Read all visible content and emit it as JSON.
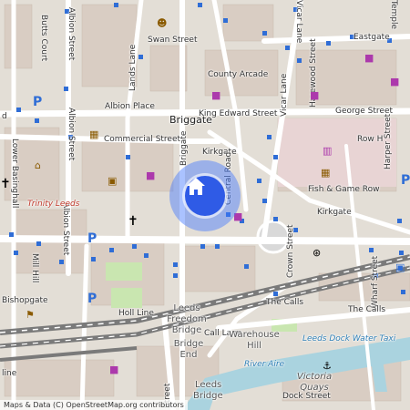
{
  "map": {
    "attribution": "Maps & Data (C) OpenStreetMap.org contributors",
    "location_marker": "home-icon",
    "colors": {
      "background": "#e3ded6",
      "street": "#ffffff",
      "building": "#d6c8bd",
      "water": "#aad3df",
      "rail": "#707070",
      "bus_stop": "#2f6dd6",
      "park": "#c9e6b0",
      "marker": "#2f5be6"
    },
    "labels": {
      "vicar_lane_top": "Vicar Lane",
      "eastgate": "Eastgate",
      "temple": "Temple",
      "butts_court": "Butts Court",
      "albion_street_top": "Albion Street",
      "lands_lane": "Lands Lane",
      "swan_street": "Swan Street",
      "county_arcade": "County Arcade",
      "harewood_street": "Harewood Street",
      "albion_place": "Albion Place",
      "briggate": "Briggate",
      "king_edward_street": "King Edward Street",
      "george_street": "George Street",
      "vicar_lane_mid": "Vicar Lane",
      "commercial_street": "Commercial Street",
      "albion_street_mid": "Albion Street",
      "albion_street_low": "Albion Street",
      "kirkgate_top": "Kirkgate",
      "row_h": "Row H",
      "harper_street": "Harper Street",
      "lower_basinghall": "Lower Basinghall",
      "briggate_side": "Briggate",
      "central_road": "Central Road",
      "trinity_leeds": "Trinity Leeds",
      "fish_game_row": "Fish & Game Row",
      "kirkgate_right": "Kirkgate",
      "mill_hill": "Mill Hill",
      "crown_street": "Crown Street",
      "bishopgate": "Bishopgate",
      "wharf_street": "Wharf Street",
      "the_calls_1": "The Calls",
      "the_calls_2": "The Calls",
      "leeds_freedom_bridge": "Leeds Freedom Bridge",
      "call_lane": "Call Lane",
      "warehouse_hill": "Warehouse Hill",
      "hol_line": "Holl Line",
      "leeds_dock_water_taxi": "Leeds Dock Water Taxi",
      "bridge_end": "Bridge End",
      "river_aire": "River Aire",
      "victoria_quays": "Victoria Quays",
      "leeds_bottom": "Leeds",
      "bridge_bottom": "Bridge",
      "street_bottom": "Street",
      "dock_street": "Dock Street",
      "nele_line": "line",
      "fd": "d"
    }
  }
}
